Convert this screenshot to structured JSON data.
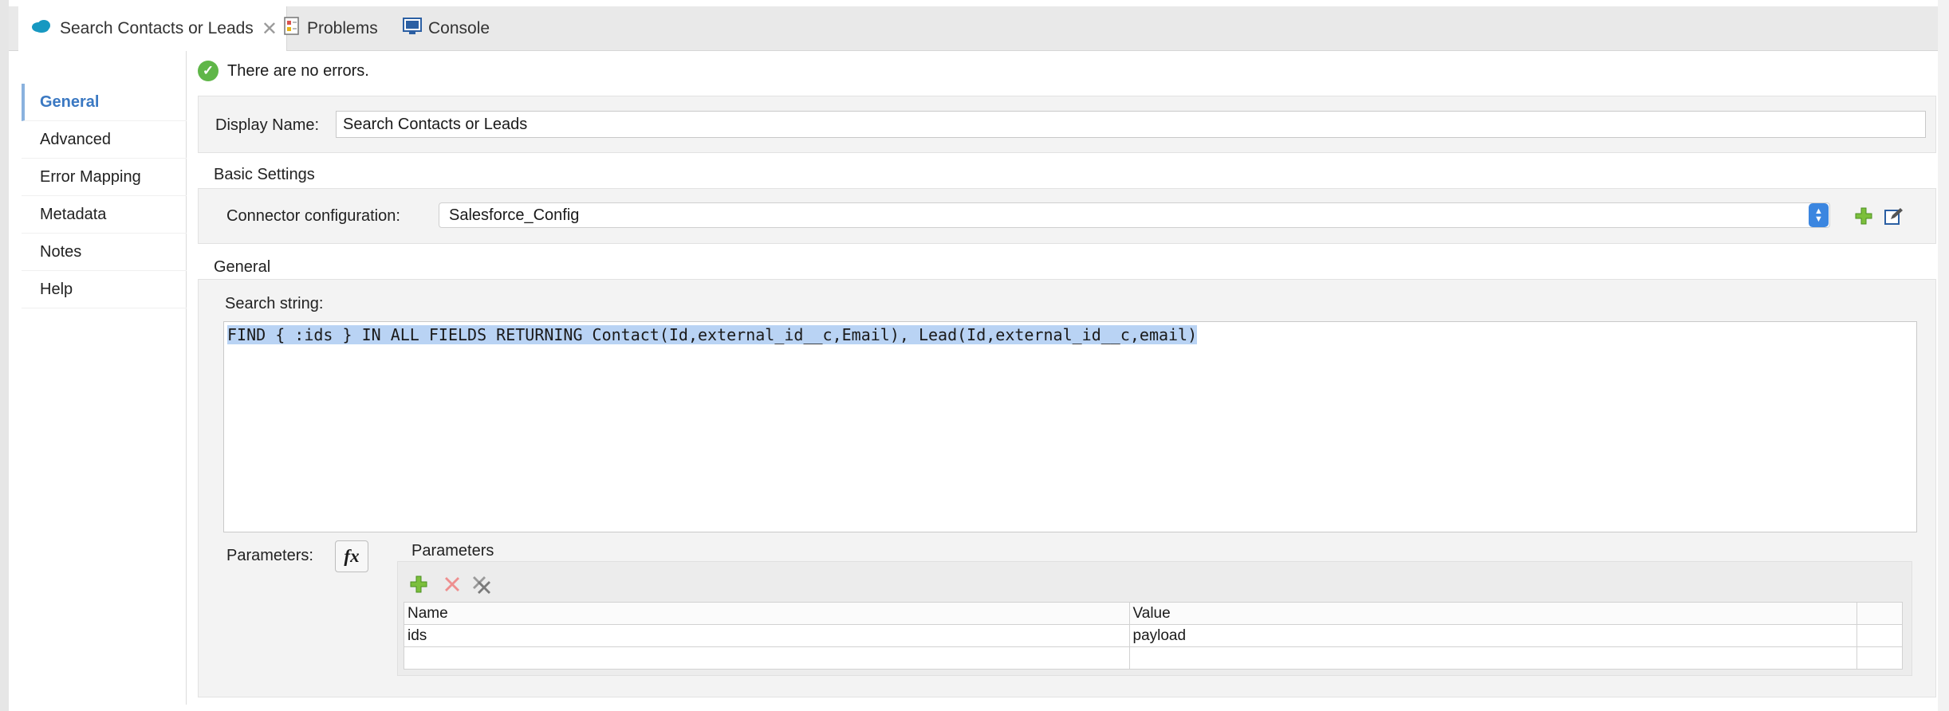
{
  "tabs": [
    {
      "label": "Search Contacts or Leads",
      "icon": "salesforce-cloud-icon",
      "active": true
    },
    {
      "label": "Problems",
      "icon": "problems-icon"
    },
    {
      "label": "Console",
      "icon": "console-icon"
    }
  ],
  "sidebar": {
    "items": [
      {
        "label": "General",
        "active": true
      },
      {
        "label": "Advanced"
      },
      {
        "label": "Error Mapping"
      },
      {
        "label": "Metadata"
      },
      {
        "label": "Notes"
      },
      {
        "label": "Help"
      }
    ]
  },
  "status": {
    "text": "There are no errors.",
    "icon": "check-circle-icon",
    "color": "#5fb648"
  },
  "display_name": {
    "label": "Display Name:",
    "value": "Search Contacts or Leads"
  },
  "basic_settings": {
    "title": "Basic Settings",
    "connector_label": "Connector configuration:",
    "connector_value": "Salesforce_Config"
  },
  "general": {
    "title": "General",
    "search_label": "Search string:",
    "search_value": "FIND { :ids } IN ALL FIELDS RETURNING Contact(Id,external_id__c,Email), Lead(Id,external_id__c,email)"
  },
  "parameters": {
    "label": "Parameters:",
    "fx_label": "fx",
    "group_title": "Parameters",
    "columns": [
      "Name",
      "Value"
    ],
    "rows": [
      {
        "name": "ids",
        "value": "payload"
      }
    ]
  },
  "colors": {
    "accent": "#3a78c2",
    "select_button": "#3b86e0",
    "highlight": "#b9d3f4"
  }
}
